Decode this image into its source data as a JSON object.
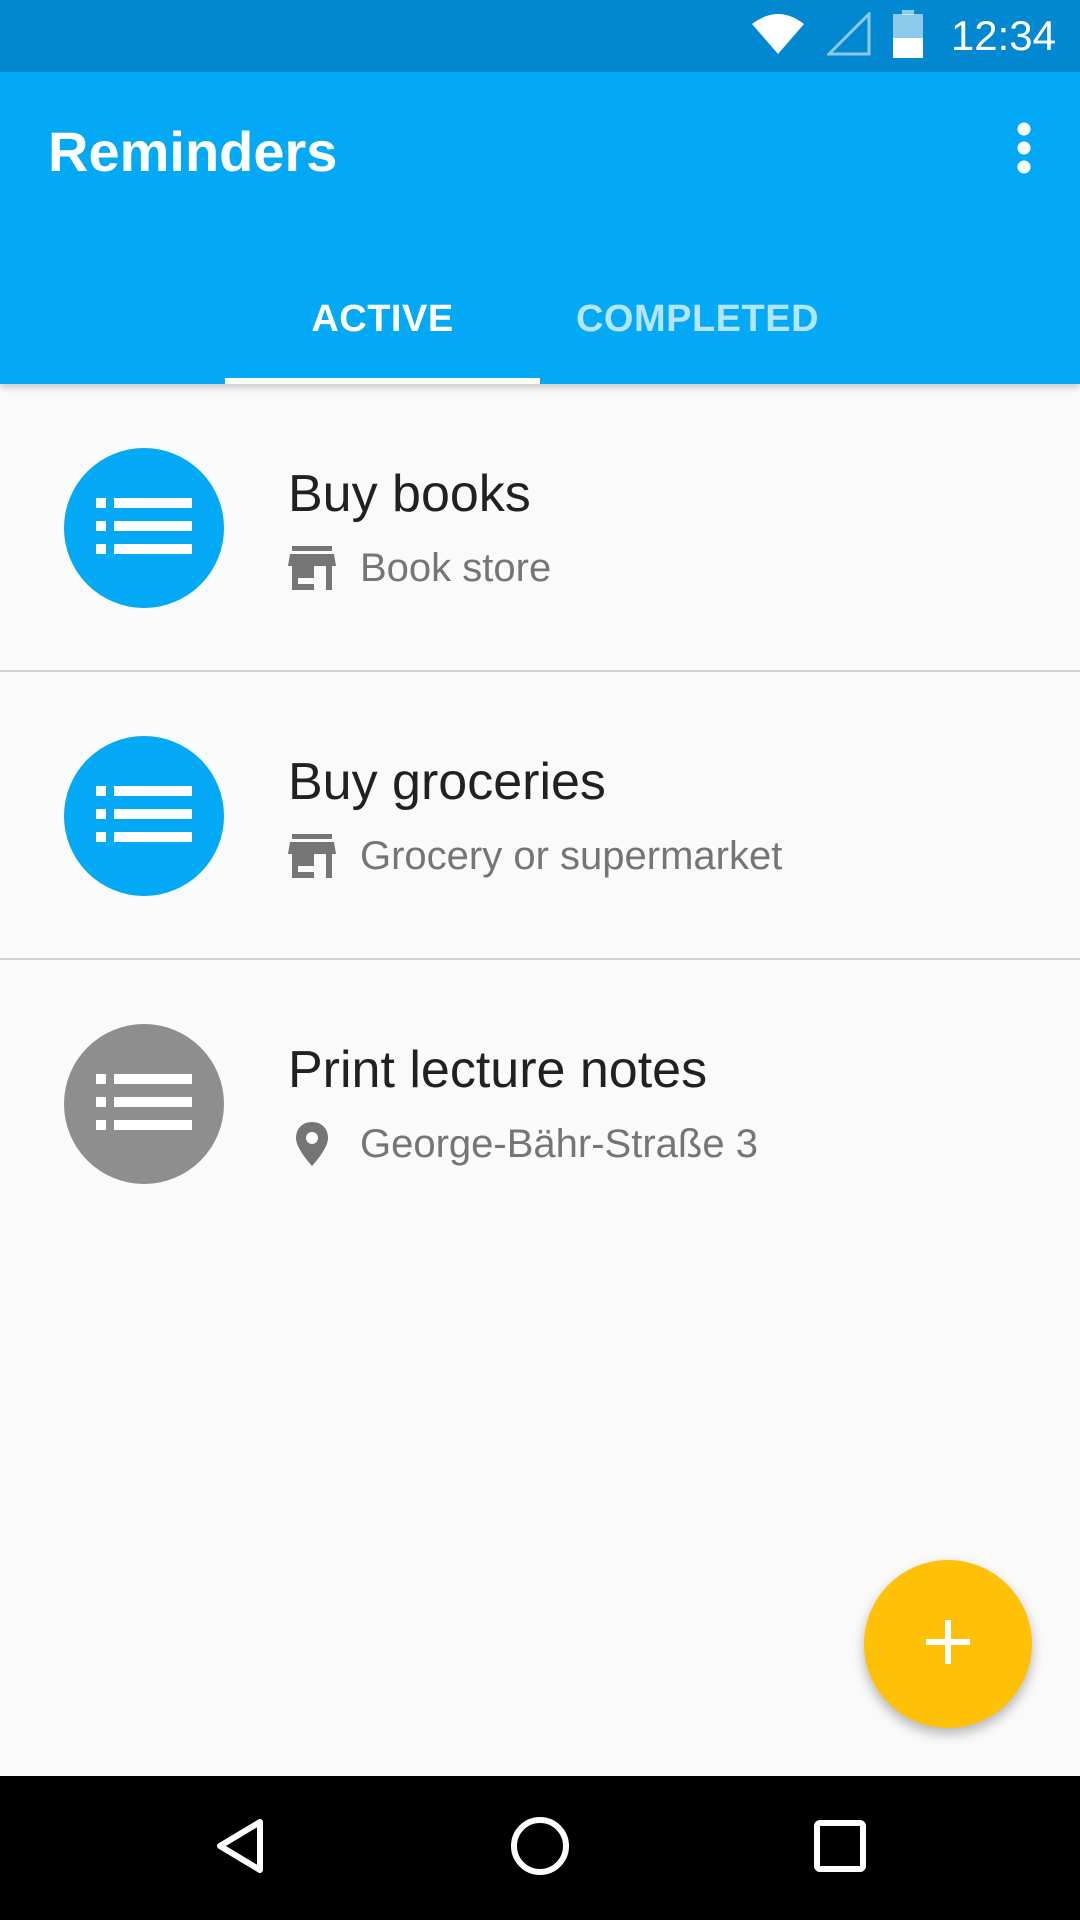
{
  "status_bar": {
    "time": "12:34"
  },
  "app_bar": {
    "title": "Reminders",
    "overflow_icon": "more-vert-icon",
    "color": "#03A9F4"
  },
  "tabs": [
    {
      "label": "ACTIVE",
      "selected": true
    },
    {
      "label": "COMPLETED",
      "selected": false
    }
  ],
  "reminders": [
    {
      "title": "Buy books",
      "location_type_icon": "store-icon",
      "location": "Book store",
      "avatar_color": "#03A9F4"
    },
    {
      "title": "Buy groceries",
      "location_type_icon": "store-icon",
      "location": "Grocery or supermarket",
      "avatar_color": "#03A9F4"
    },
    {
      "title": "Print lecture notes",
      "location_type_icon": "place-icon",
      "location": "George-Bähr-Straße 3",
      "avatar_color": "#8E8E8E"
    }
  ],
  "fab": {
    "icon": "add-icon",
    "color": "#FFC107"
  },
  "nav_bar": {
    "back_icon": "back-icon",
    "home_icon": "home-icon",
    "recents_icon": "recents-icon"
  }
}
